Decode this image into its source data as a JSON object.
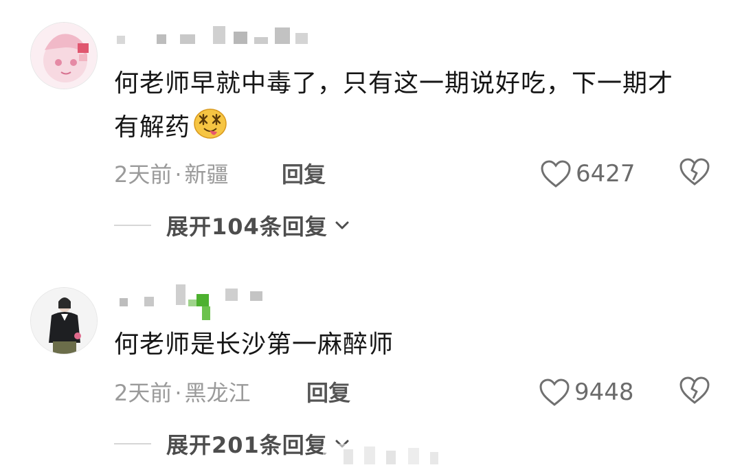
{
  "comments": [
    {
      "text": "何老师早就中毒了，只有这一期说好吃，下一期才有解药",
      "time": "2天前",
      "separator": "·",
      "location": "新疆",
      "reply_label": "回复",
      "likes": "6427",
      "expand_label": "展开104条回复",
      "emoji": "drooling-dizzy-face-emoji"
    },
    {
      "text": "何老师是长沙第一麻醉师",
      "time": "2天前",
      "separator": "·",
      "location": "黑龙江",
      "reply_label": "回复",
      "likes": "9448",
      "expand_label": "展开201条回复"
    }
  ],
  "icons": {
    "like": "heart-outline-icon",
    "dislike": "broken-heart-icon",
    "expand": "chevron-down-icon"
  },
  "colors": {
    "text": "#161616",
    "meta": "#9a9a9a",
    "icon": "#707070"
  }
}
